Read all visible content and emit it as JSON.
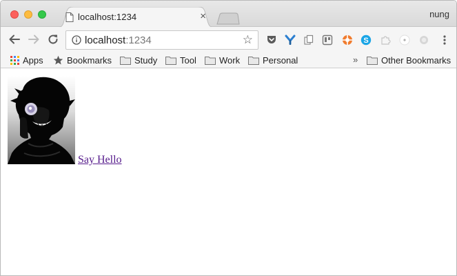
{
  "browser": {
    "tab_title": "localhost:1234",
    "tab_close": "×",
    "profile_name": "nung"
  },
  "omnibox": {
    "host": "localhost",
    "port": ":1234"
  },
  "bookmarks": {
    "apps": "Apps",
    "items": [
      "Bookmarks",
      "Study",
      "Tool",
      "Work",
      "Personal"
    ],
    "overflow": "»",
    "other": "Other Bookmarks"
  },
  "page": {
    "link_text": "Say Hello"
  },
  "colors": {
    "link_visited": "#551a8b",
    "close_red": "#fc605c",
    "minimize_yellow": "#fdbc40",
    "zoom_green": "#34c84a"
  }
}
